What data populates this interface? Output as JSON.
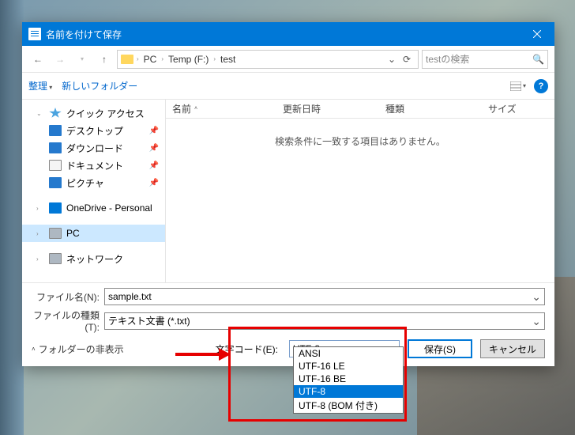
{
  "titlebar": {
    "title": "名前を付けて保存"
  },
  "nav": {
    "breadcrumbs": [
      "PC",
      "Temp (F:)",
      "test"
    ],
    "search_placeholder": "testの検索"
  },
  "toolbar": {
    "organize": "整理",
    "new_folder": "新しいフォルダー"
  },
  "sidebar": {
    "quick_access": "クイック アクセス",
    "desktop": "デスクトップ",
    "downloads": "ダウンロード",
    "documents": "ドキュメント",
    "pictures": "ピクチャ",
    "onedrive": "OneDrive - Personal",
    "pc": "PC",
    "network": "ネットワーク"
  },
  "columns": {
    "name": "名前",
    "date": "更新日時",
    "type": "種類",
    "size": "サイズ"
  },
  "main": {
    "empty_message": "検索条件に一致する項目はありません。"
  },
  "form": {
    "filename_label": "ファイル名(N):",
    "filename_value": "sample.txt",
    "filetype_label": "ファイルの種類(T):",
    "filetype_value": "テキスト文書 (*.txt)",
    "encoding_label": "文字コード(E):",
    "encoding_value": "UTF-8",
    "encoding_options": [
      "ANSI",
      "UTF-16 LE",
      "UTF-16 BE",
      "UTF-8",
      "UTF-8 (BOM 付き)"
    ]
  },
  "footer": {
    "hide_folders": "フォルダーの非表示",
    "save": "保存(S)",
    "cancel": "キャンセル"
  }
}
